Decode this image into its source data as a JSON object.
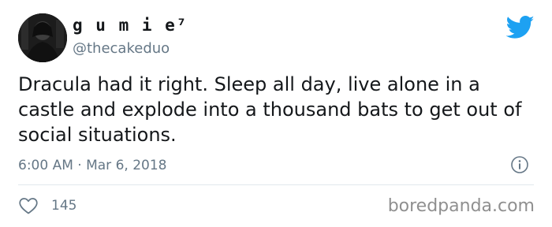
{
  "author": {
    "display_name": "g u m i e⁷",
    "handle": "@thecakeduo",
    "avatar_icon": "profile-photo"
  },
  "tweet": {
    "text": "Dracula had it right. Sleep all day, live alone in a castle and explode into a thousand bats to get out of social situations.",
    "timestamp": "6:00 AM · Mar 6, 2018"
  },
  "actions": {
    "like_icon": "heart-outline-icon",
    "like_count": "145",
    "info_icon": "info-icon"
  },
  "brand": {
    "platform_icon": "twitter-bird-icon",
    "platform_color": "#1da1f2",
    "watermark": "boredpanda.com"
  },
  "colors": {
    "text_primary": "#14171a",
    "text_secondary": "#657786",
    "divider": "#e1e8ed"
  }
}
